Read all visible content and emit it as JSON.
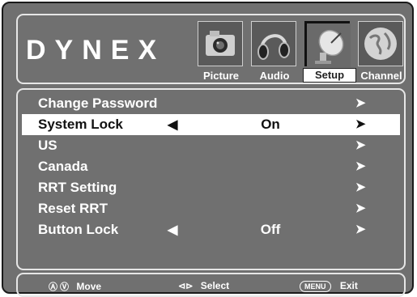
{
  "brand": "DYNEX",
  "tabs": [
    {
      "label": "Picture",
      "icon": "camera-icon"
    },
    {
      "label": "Audio",
      "icon": "headphones-icon"
    },
    {
      "label": "Setup",
      "icon": "satellite-dish-icon",
      "active": true
    },
    {
      "label": "Channel",
      "icon": "globe-icon"
    }
  ],
  "menu": {
    "items": [
      {
        "label": "Change Password",
        "value": "",
        "left_arrow": "",
        "right_arrow": "➤"
      },
      {
        "label": "System Lock",
        "value": "On",
        "left_arrow": "◀",
        "right_arrow": "➤",
        "selected": true
      },
      {
        "label": "US",
        "value": "",
        "left_arrow": "",
        "right_arrow": "➤"
      },
      {
        "label": "Canada",
        "value": "",
        "left_arrow": "",
        "right_arrow": "➤"
      },
      {
        "label": "RRT Setting",
        "value": "",
        "left_arrow": "",
        "right_arrow": "➤"
      },
      {
        "label": "Reset RRT",
        "value": "",
        "left_arrow": "",
        "right_arrow": "➤"
      },
      {
        "label": "Button Lock",
        "value": "Off",
        "left_arrow": "◀",
        "right_arrow": "➤"
      }
    ]
  },
  "footer": {
    "move_icon": "Ⓐ Ⓥ",
    "move_label": "Move",
    "select_icon": "⊲⊳",
    "select_label": "Select",
    "menu_key": "MENU",
    "exit_label": "Exit"
  },
  "colors": {
    "screen_bg": "#707070",
    "text": "#ffffff",
    "highlight": "#ffffff"
  }
}
